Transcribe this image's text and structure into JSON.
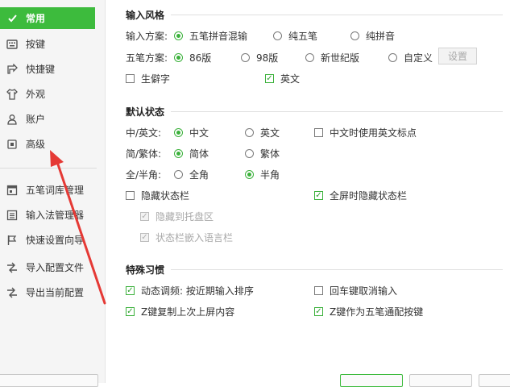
{
  "sidebar": {
    "items": [
      {
        "label": "常用",
        "icon": "checkmark-icon",
        "active": true
      },
      {
        "label": "按键",
        "icon": "keyboard-icon"
      },
      {
        "label": "快捷键",
        "icon": "shortcut-icon"
      },
      {
        "label": "外观",
        "icon": "shirt-icon"
      },
      {
        "label": "账户",
        "icon": "user-icon"
      },
      {
        "label": "高级",
        "icon": "advanced-icon"
      },
      {
        "label": "五笔词库管理",
        "icon": "dictionary-icon"
      },
      {
        "label": "输入法管理器",
        "icon": "list-icon"
      },
      {
        "label": "快速设置向导",
        "icon": "flag-icon"
      },
      {
        "label": "导入配置文件",
        "icon": "import-icon"
      },
      {
        "label": "导出当前配置",
        "icon": "export-icon"
      }
    ]
  },
  "input_style": {
    "title": "输入风格",
    "scheme_label": "输入方案:",
    "scheme_options": [
      "五笔拼音混输",
      "纯五笔",
      "纯拼音"
    ],
    "wubi_label": "五笔方案:",
    "wubi_options": [
      "86版",
      "98版",
      "新世纪版",
      "自定义"
    ],
    "settings_button": "设置",
    "rare_chars": "生僻字",
    "english": "英文"
  },
  "default_state": {
    "title": "默认状态",
    "cn_en_label": "中/英文:",
    "cn_en_options": [
      "中文",
      "英文"
    ],
    "cn_use_en_punct": "中文时使用英文标点",
    "simp_trad_label": "简/繁体:",
    "simp_trad_options": [
      "简体",
      "繁体"
    ],
    "width_label": "全/半角:",
    "width_options": [
      "全角",
      "半角"
    ],
    "hide_status": "隐藏状态栏",
    "fullscreen_hide": "全屏时隐藏状态栏",
    "hide_to_tray": "隐藏到托盘区",
    "embed_lang_bar": "状态栏嵌入语言栏"
  },
  "habits": {
    "title": "特殊习惯",
    "dynamic_freq": "动态调频: 按近期输入排序",
    "enter_cancel": "回车键取消输入",
    "z_copy": "Z键复制上次上屏内容",
    "z_wildcard": "Z键作为五笔通配按键"
  },
  "colors": {
    "accent": "#3dbb3d",
    "arrow": "#e53935"
  }
}
